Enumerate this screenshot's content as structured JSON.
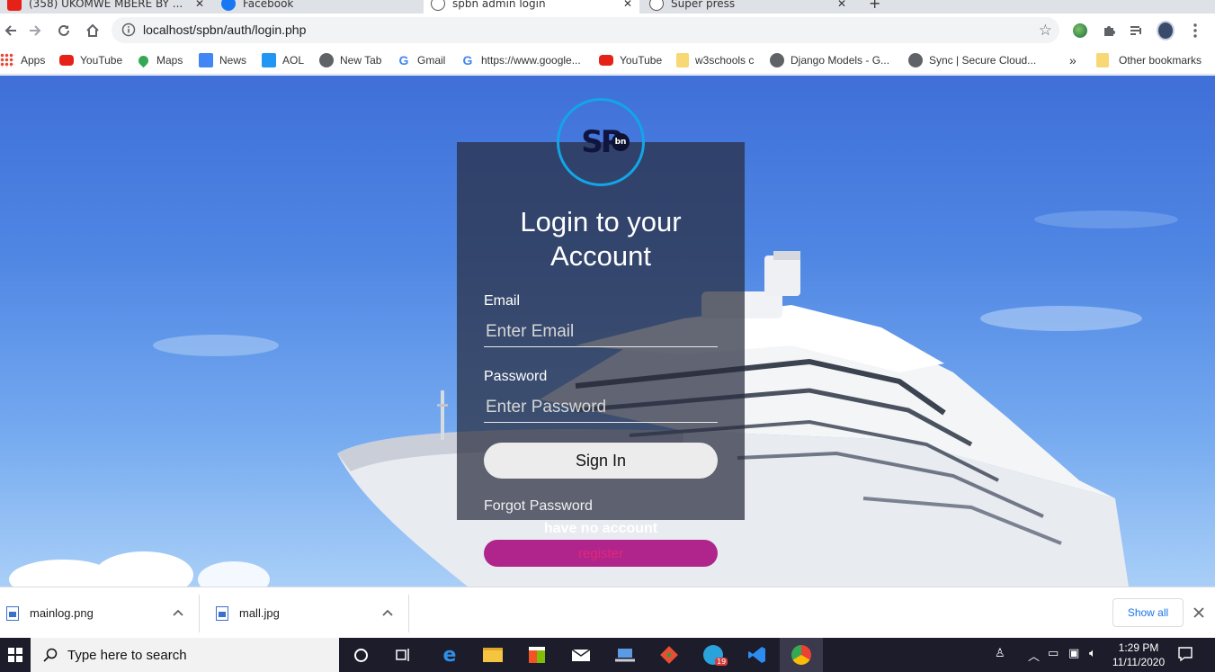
{
  "browser": {
    "tabs": [
      {
        "title": "(358) UKOMWE MBERE BY ..."
      },
      {
        "title": "Facebook"
      },
      {
        "title": "spbn admin login"
      },
      {
        "title": "Super press"
      }
    ],
    "url": "localhost/spbn/auth/login.php",
    "bookmarks": [
      {
        "label": "Apps",
        "icon": "apps-icon"
      },
      {
        "label": "YouTube",
        "icon": "youtube-icon"
      },
      {
        "label": "Maps",
        "icon": "maps-icon"
      },
      {
        "label": "News",
        "icon": "news-icon"
      },
      {
        "label": "AOL",
        "icon": "aol-icon"
      },
      {
        "label": "New Tab",
        "icon": "globe-icon"
      },
      {
        "label": "Gmail",
        "icon": "google-icon"
      },
      {
        "label": "https://www.google...",
        "icon": "google-icon"
      },
      {
        "label": "YouTube",
        "icon": "youtube-icon"
      },
      {
        "label": "w3schools c",
        "icon": "folder-icon"
      },
      {
        "label": "Django Models - G...",
        "icon": "globe-icon"
      },
      {
        "label": "Sync | Secure Cloud...",
        "icon": "globe-icon"
      }
    ],
    "overflow": "»",
    "other_bookmarks": "Other bookmarks"
  },
  "login": {
    "logo_text": "SP",
    "logo_badge": "bn",
    "heading_line1": "Login to your",
    "heading_line2": "Account",
    "email_label": "Email",
    "email_placeholder": "Enter Email",
    "password_label": "Password",
    "password_placeholder": "Enter Password",
    "signin_label": "Sign In",
    "forgot_label": "Forgot Password",
    "no_account_text": "have no account",
    "register_label": "register"
  },
  "downloads": {
    "items": [
      {
        "name": "mainlog.png"
      },
      {
        "name": "mall.jpg"
      }
    ],
    "show_all": "Show all"
  },
  "taskbar": {
    "search_placeholder": "Type here to search",
    "mail_badge": "19",
    "time": "1:29 PM",
    "date": "11/11/2020"
  }
}
